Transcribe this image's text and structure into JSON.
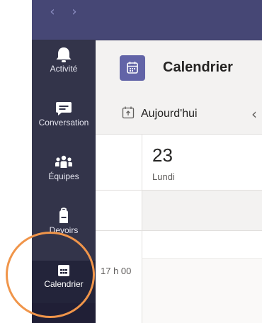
{
  "window": {
    "back_arrow": "‹",
    "forward_arrow": "›"
  },
  "rail": {
    "items": [
      {
        "label": "Activité",
        "icon": "bell-icon"
      },
      {
        "label": "Conversation",
        "icon": "chat-icon"
      },
      {
        "label": "Équipes",
        "icon": "teams-icon"
      },
      {
        "label": "Devoirs",
        "icon": "backpack-icon"
      },
      {
        "label": "Calendrier",
        "icon": "calendar-icon",
        "selected": true
      }
    ]
  },
  "header": {
    "title": "Calendrier",
    "icon": "calendar-icon"
  },
  "toolbar": {
    "today_label": "Aujourd'hui",
    "prev_glyph": "‹"
  },
  "calendar": {
    "day_number": "23",
    "day_name": "Lundi",
    "time_label": "17 h 00"
  },
  "colors": {
    "titlebar": "#464775",
    "rail": "#33344a",
    "accent": "#6264a7",
    "highlight": "#f0954a"
  }
}
